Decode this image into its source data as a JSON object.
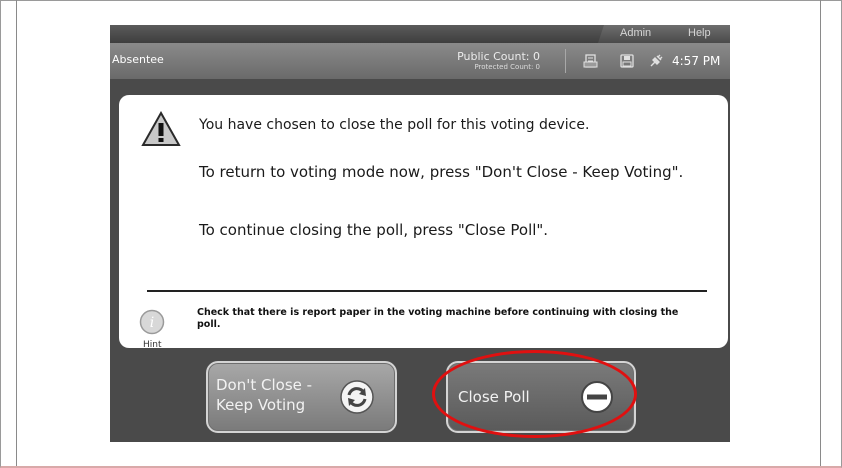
{
  "menu": {
    "admin": "Admin",
    "help": "Help"
  },
  "status": {
    "mode": "Absentee",
    "public_count": "Public Count: 0",
    "protected_count": "Protected Count: 0",
    "time": "4:57 PM"
  },
  "dialog": {
    "line1": "You have chosen to close the poll for this voting device.",
    "line2": "To return to voting mode now, press \"Don't Close - Keep Voting\".",
    "line3": "To continue closing the poll, press \"Close Poll\".",
    "hint_label": "Hint",
    "hint_text": "Check that there is report paper in the voting machine before continuing with closing the poll."
  },
  "buttons": {
    "keep_voting": "Don't Close - Keep Voting",
    "close_poll": "Close Poll"
  },
  "colors": {
    "annotation": "#e01010",
    "screen_bg": "#4a4a4a"
  },
  "icons": {
    "warning": "warning-icon",
    "hint": "info-hint-icon",
    "printer": "printer-icon",
    "memory": "memory-card-icon",
    "power": "power-plug-icon",
    "refresh": "refresh-icon",
    "close": "close-minus-icon"
  }
}
